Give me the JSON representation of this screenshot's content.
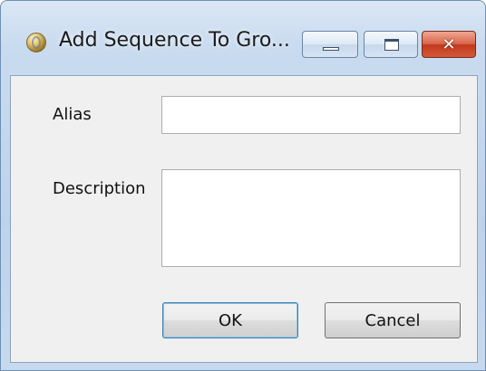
{
  "window": {
    "title": "Add Sequence To Gro...",
    "app_icon": "globe-app-icon",
    "caption_buttons": {
      "minimize_icon": "minimize-icon",
      "maximize_icon": "maximize-icon",
      "close_icon": "close-icon",
      "close_glyph": "✕"
    }
  },
  "form": {
    "alias_label": "Alias",
    "alias_value": "",
    "description_label": "Description",
    "description_value": ""
  },
  "buttons": {
    "ok_label": "OK",
    "cancel_label": "Cancel"
  },
  "colors": {
    "close_button": "#c1391c",
    "frame": "#bdd3ec"
  }
}
